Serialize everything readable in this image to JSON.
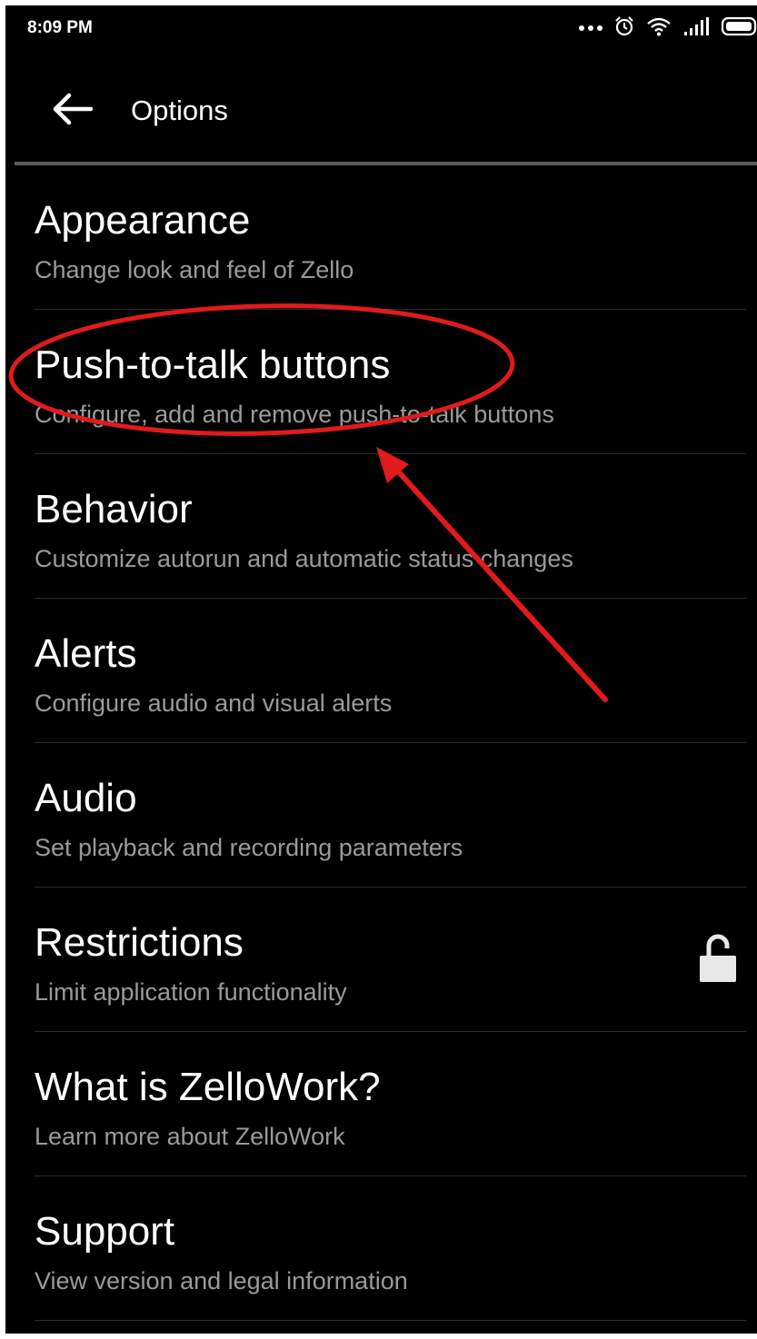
{
  "status_bar": {
    "time": "8:09 PM",
    "icons": [
      "more-dots-icon",
      "alarm-icon",
      "wifi-icon",
      "signal-icon",
      "battery-icon"
    ]
  },
  "toolbar": {
    "back_icon": "back-arrow-icon",
    "title": "Options"
  },
  "menu": {
    "items": [
      {
        "title": "Appearance",
        "subtitle": "Change look and feel of Zello"
      },
      {
        "title": "Push-to-talk buttons",
        "subtitle": "Configure, add and remove push-to-talk buttons"
      },
      {
        "title": "Behavior",
        "subtitle": "Customize autorun and automatic status changes"
      },
      {
        "title": "Alerts",
        "subtitle": "Configure audio and visual alerts"
      },
      {
        "title": "Audio",
        "subtitle": "Set playback and recording parameters"
      },
      {
        "title": "Restrictions",
        "subtitle": "Limit application functionality",
        "icon": "unlocked-padlock-icon"
      },
      {
        "title": "What is ZelloWork?",
        "subtitle": "Learn more about ZelloWork"
      },
      {
        "title": "Support",
        "subtitle": "View version and legal information"
      }
    ]
  },
  "annotation": {
    "highlight": "Push-to-talk buttons",
    "color": "#e01b1b"
  },
  "colors": {
    "background": "#000000",
    "title_text": "#ffffff",
    "subtitle_text": "#9a9a9a",
    "annotation": "#e01b1b"
  }
}
